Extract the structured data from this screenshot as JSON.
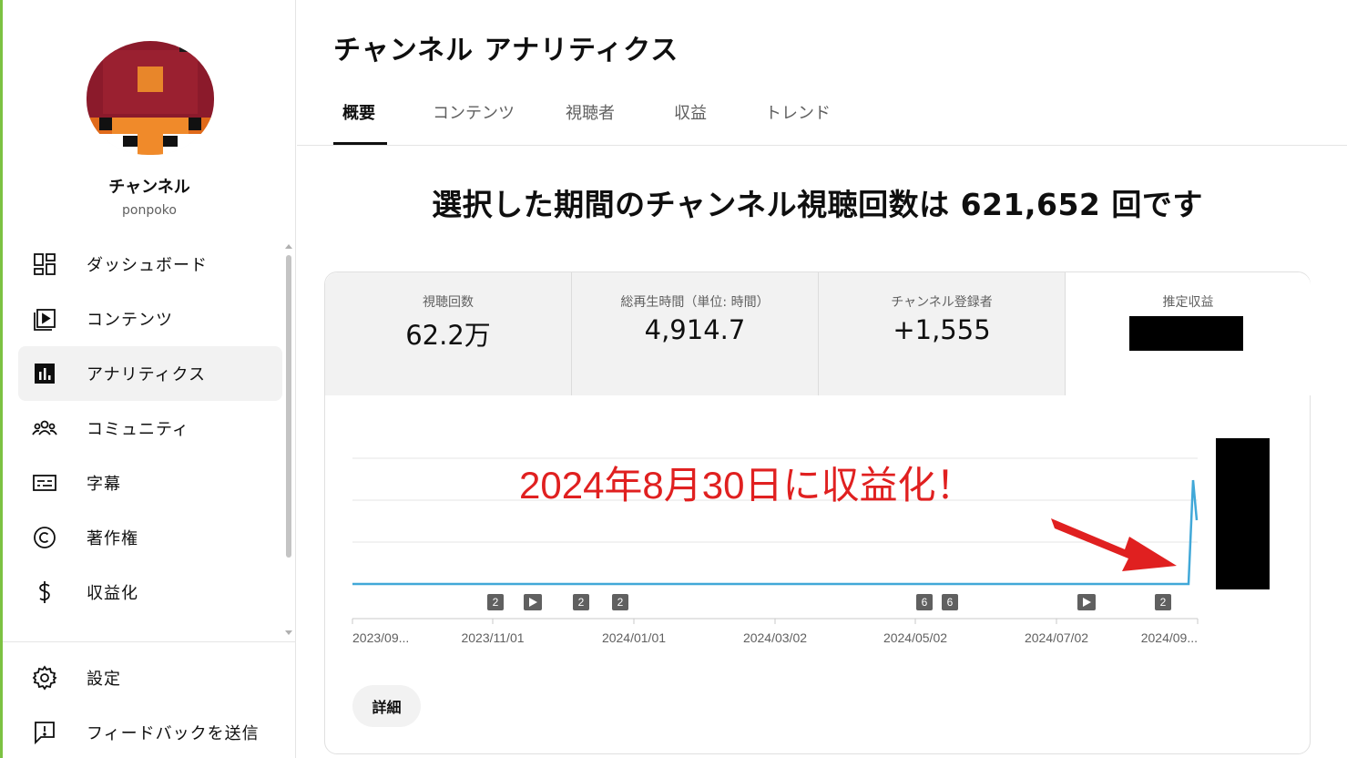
{
  "sidebar": {
    "channel_name": "チャンネル",
    "channel_handle": "ponpoko",
    "items": [
      {
        "label": "ダッシュボード",
        "icon": "dashboard-icon"
      },
      {
        "label": "コンテンツ",
        "icon": "content-icon"
      },
      {
        "label": "アナリティクス",
        "icon": "analytics-icon",
        "active": true
      },
      {
        "label": "コミュニティ",
        "icon": "community-icon"
      },
      {
        "label": "字幕",
        "icon": "subtitles-icon"
      },
      {
        "label": "著作権",
        "icon": "copyright-icon"
      },
      {
        "label": "収益化",
        "icon": "dollar-icon"
      }
    ],
    "bottom_items": [
      {
        "label": "設定",
        "icon": "gear-icon"
      },
      {
        "label": "フィードバックを送信",
        "icon": "feedback-icon"
      }
    ]
  },
  "header": {
    "title": "チャンネル アナリティクス"
  },
  "tabs": [
    "概要",
    "コンテンツ",
    "視聴者",
    "収益",
    "トレンド"
  ],
  "headline": "選択した期間のチャンネル視聴回数は 621,652 回です",
  "metrics": [
    {
      "label": "視聴回数",
      "value": "62.2万"
    },
    {
      "label": "総再生時間（単位: 時間）",
      "value": "4,914.7"
    },
    {
      "label": "チャンネル登録者",
      "value": "+1,555"
    },
    {
      "label": "推定収益",
      "value": ""
    }
  ],
  "annotation": "2024年8月30日に収益化！",
  "chart_data": {
    "type": "line",
    "x_tick_labels": [
      "2023/09...",
      "2023/11/01",
      "2024/01/01",
      "2024/03/02",
      "2024/05/02",
      "2024/07/02",
      "2024/09..."
    ],
    "markers": [
      "2",
      "play",
      "2",
      "2",
      "6",
      "6",
      "play",
      "2"
    ],
    "series_color": "#41a8d8",
    "note": ""
  },
  "details_button": "詳細",
  "colors": {
    "accent_red": "#e02020",
    "line_blue": "#41a8d8"
  }
}
